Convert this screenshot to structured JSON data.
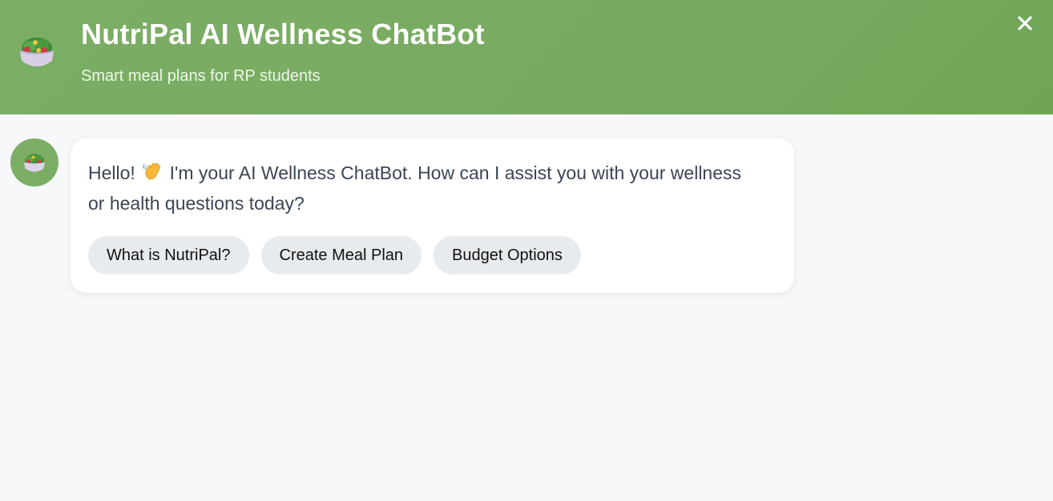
{
  "header": {
    "logo_icon": "salad-bowl-icon",
    "title": "NutriPal AI Wellness ChatBot",
    "subtitle": "Smart meal plans for RP students",
    "close_icon": "close-icon",
    "background_color": "#7bae64"
  },
  "chat": {
    "messages": [
      {
        "sender": "bot",
        "avatar_icon": "salad-bowl-icon",
        "text_before_emoji": "Hello!",
        "emoji": "waving-hand-icon",
        "text_after_emoji": "I'm your AI Wellness ChatBot. How can I assist you with your wellness or health questions today?",
        "quick_replies": [
          {
            "label": "What is NutriPal?"
          },
          {
            "label": "Create Meal Plan"
          },
          {
            "label": "Budget Options"
          }
        ]
      }
    ]
  },
  "colors": {
    "accent": "#7bae64",
    "chip_background": "#e8ebee",
    "page_background": "#f7f8fa",
    "message_text": "#3b4555"
  }
}
